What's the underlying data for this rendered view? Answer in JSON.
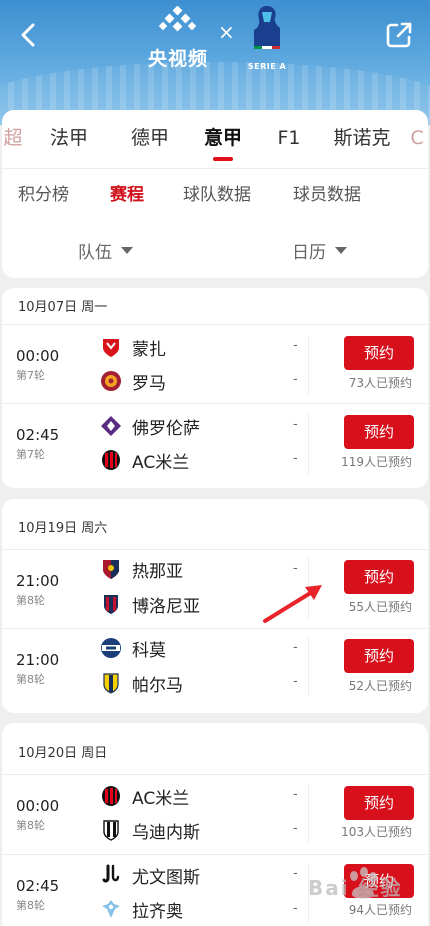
{
  "header": {
    "brand_name": "央视频",
    "times": "×",
    "league_name": "SERIE A",
    "colors": {
      "sky": "#4a9ad6",
      "accent": "#e40f19"
    }
  },
  "tabs": [
    "超",
    "法甲",
    "德甲",
    "意甲",
    "F1",
    "斯诺克",
    "C"
  ],
  "active_tab": "意甲",
  "subtabs": [
    "积分榜",
    "赛程",
    "球队数据",
    "球员数据"
  ],
  "active_subtab": "赛程",
  "filters": {
    "team": "队伍",
    "calendar": "日历"
  },
  "reserve_label": "预约",
  "days": [
    {
      "date": "10月07日 周一",
      "matches": [
        {
          "time": "00:00",
          "round": "第7轮",
          "home": "蒙扎",
          "away": "罗马",
          "home_score": "-",
          "away_score": "-",
          "reservations": "73人已预约",
          "home_icon": "monza-crest-icon",
          "away_icon": "roma-crest-icon"
        },
        {
          "time": "02:45",
          "round": "第7轮",
          "home": "佛罗伦萨",
          "away": "AC米兰",
          "home_score": "-",
          "away_score": "-",
          "reservations": "119人已预约",
          "home_icon": "fiorentina-crest-icon",
          "away_icon": "ac-milan-crest-icon"
        }
      ]
    },
    {
      "date": "10月19日 周六",
      "matches": [
        {
          "time": "21:00",
          "round": "第8轮",
          "home": "热那亚",
          "away": "博洛尼亚",
          "home_score": "-",
          "away_score": "-",
          "reservations": "55人已预约",
          "home_icon": "genoa-crest-icon",
          "away_icon": "bologna-crest-icon"
        },
        {
          "time": "21:00",
          "round": "第8轮",
          "home": "科莫",
          "away": "帕尔马",
          "home_score": "-",
          "away_score": "-",
          "reservations": "52人已预约",
          "home_icon": "como-crest-icon",
          "away_icon": "parma-crest-icon"
        }
      ]
    },
    {
      "date": "10月20日 周日",
      "matches": [
        {
          "time": "00:00",
          "round": "第8轮",
          "home": "AC米兰",
          "away": "乌迪内斯",
          "home_score": "-",
          "away_score": "-",
          "reservations": "103人已预约",
          "home_icon": "ac-milan-crest-icon",
          "away_icon": "udinese-crest-icon"
        },
        {
          "time": "02:45",
          "round": "第8轮",
          "home": "尤文图斯",
          "away": "拉齐奥",
          "home_score": "-",
          "away_score": "-",
          "reservations": "94人已预约",
          "home_icon": "juventus-crest-icon",
          "away_icon": "lazio-crest-icon"
        }
      ]
    }
  ],
  "watermark": "Bai 经验"
}
